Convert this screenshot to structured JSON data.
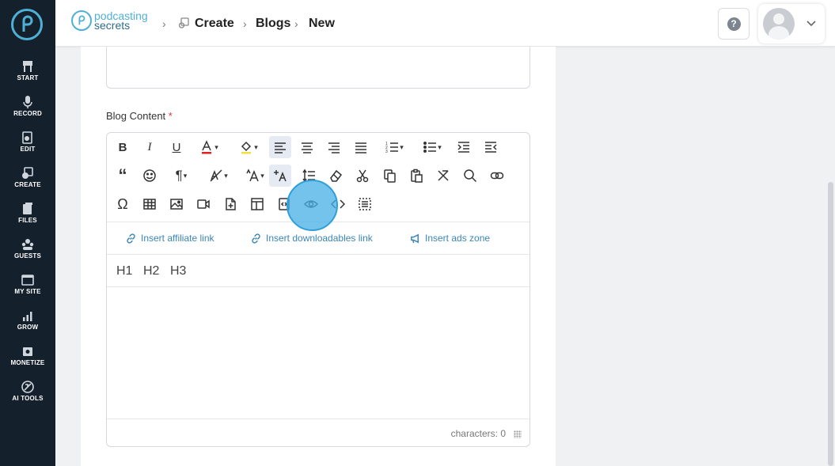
{
  "sidebar": {
    "items": [
      {
        "label": "START",
        "icon": "start-icon"
      },
      {
        "label": "RECORD",
        "icon": "microphone-icon"
      },
      {
        "label": "EDIT",
        "icon": "edit-icon"
      },
      {
        "label": "CREATE",
        "icon": "create-icon"
      },
      {
        "label": "FILES",
        "icon": "files-icon"
      },
      {
        "label": "GUESTS",
        "icon": "guests-icon"
      },
      {
        "label": "MY SITE",
        "icon": "my-site-icon"
      },
      {
        "label": "GROW",
        "icon": "grow-icon"
      },
      {
        "label": "MONETIZE",
        "icon": "monetize-icon"
      },
      {
        "label": "AI TOOLS",
        "icon": "ai-tools-icon"
      }
    ]
  },
  "header": {
    "brand_line1": "podcasting",
    "brand_line2": "secrets",
    "breadcrumbs": [
      "Create",
      "Blogs",
      "New"
    ],
    "help_label": "?"
  },
  "form": {
    "content_label": "Blog Content",
    "required_mark": "*"
  },
  "editor": {
    "insert_links": [
      "Insert affiliate link",
      "Insert downloadables link",
      "Insert ads zone"
    ],
    "headings": [
      "H1",
      "H2",
      "H3"
    ],
    "char_count": "characters: 0"
  },
  "colors": {
    "sidebar_bg": "#15202d",
    "accent": "#4fb0d6",
    "link": "#3a86b5",
    "click_indicator": "#46afe6"
  }
}
